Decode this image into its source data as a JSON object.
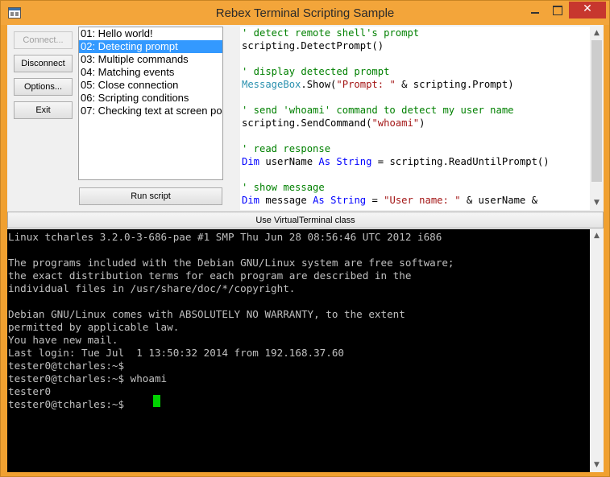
{
  "window": {
    "title": "Rebex Terminal Scripting Sample",
    "close_glyph": "✕"
  },
  "buttons": {
    "connect": "Connect...",
    "disconnect": "Disconnect",
    "options": "Options...",
    "exit": "Exit",
    "run_script": "Run script",
    "use_virtual_terminal": "Use VirtualTerminal class"
  },
  "script_list": {
    "selected_index": 1,
    "items": [
      "01: Hello world!",
      "02: Detecting prompt",
      "03: Multiple commands",
      "04: Matching events",
      "05: Close connection",
      "06: Scripting conditions",
      "07: Checking text at screen po"
    ]
  },
  "code": {
    "lines": [
      [
        {
          "t": "' detect remote shell's prompt",
          "c": "comment"
        }
      ],
      [
        {
          "t": "scripting.DetectPrompt()",
          "c": "plain"
        }
      ],
      [
        {
          "t": "",
          "c": "plain"
        }
      ],
      [
        {
          "t": "' display detected prompt",
          "c": "comment"
        }
      ],
      [
        {
          "t": "MessageBox",
          "c": "type"
        },
        {
          "t": ".Show(",
          "c": "plain"
        },
        {
          "t": "\"Prompt: \"",
          "c": "str"
        },
        {
          "t": " & scripting.Prompt)",
          "c": "plain"
        }
      ],
      [
        {
          "t": "",
          "c": "plain"
        }
      ],
      [
        {
          "t": "' send 'whoami' command to detect my user name",
          "c": "comment"
        }
      ],
      [
        {
          "t": "scripting.SendCommand(",
          "c": "plain"
        },
        {
          "t": "\"whoami\"",
          "c": "str"
        },
        {
          "t": ")",
          "c": "plain"
        }
      ],
      [
        {
          "t": "",
          "c": "plain"
        }
      ],
      [
        {
          "t": "' read response",
          "c": "comment"
        }
      ],
      [
        {
          "t": "Dim",
          "c": "kw"
        },
        {
          "t": " userName ",
          "c": "plain"
        },
        {
          "t": "As",
          "c": "kw"
        },
        {
          "t": " ",
          "c": "plain"
        },
        {
          "t": "String",
          "c": "kw"
        },
        {
          "t": " = scripting.ReadUntilPrompt()",
          "c": "plain"
        }
      ],
      [
        {
          "t": "",
          "c": "plain"
        }
      ],
      [
        {
          "t": "' show message",
          "c": "comment"
        }
      ],
      [
        {
          "t": "Dim",
          "c": "kw"
        },
        {
          "t": " message ",
          "c": "plain"
        },
        {
          "t": "As",
          "c": "kw"
        },
        {
          "t": " ",
          "c": "plain"
        },
        {
          "t": "String",
          "c": "kw"
        },
        {
          "t": " = ",
          "c": "plain"
        },
        {
          "t": "\"User name: \"",
          "c": "str"
        },
        {
          "t": " & userName &",
          "c": "plain"
        }
      ]
    ]
  },
  "terminal": {
    "lines": [
      "Linux tcharles 3.2.0-3-686-pae #1 SMP Thu Jun 28 08:56:46 UTC 2012 i686",
      "",
      "The programs included with the Debian GNU/Linux system are free software;",
      "the exact distribution terms for each program are described in the",
      "individual files in /usr/share/doc/*/copyright.",
      "",
      "Debian GNU/Linux comes with ABSOLUTELY NO WARRANTY, to the extent",
      "permitted by applicable law.",
      "You have new mail.",
      "Last login: Tue Jul  1 13:50:32 2014 from 192.168.37.60",
      "tester0@tcharles:~$",
      "tester0@tcharles:~$ whoami",
      "tester0",
      "tester0@tcharles:~$ "
    ],
    "text_color": "#c0c0c0",
    "cursor_color": "#00d200"
  },
  "scroll_glyphs": {
    "up": "▲",
    "down": "▼"
  },
  "colors": {
    "window_frame": "#f0a030",
    "selection": "#3399ff",
    "close_button": "#c7372e",
    "comment": "#008000",
    "keyword": "#0000ff",
    "string": "#a31515",
    "type": "#2b91af"
  }
}
